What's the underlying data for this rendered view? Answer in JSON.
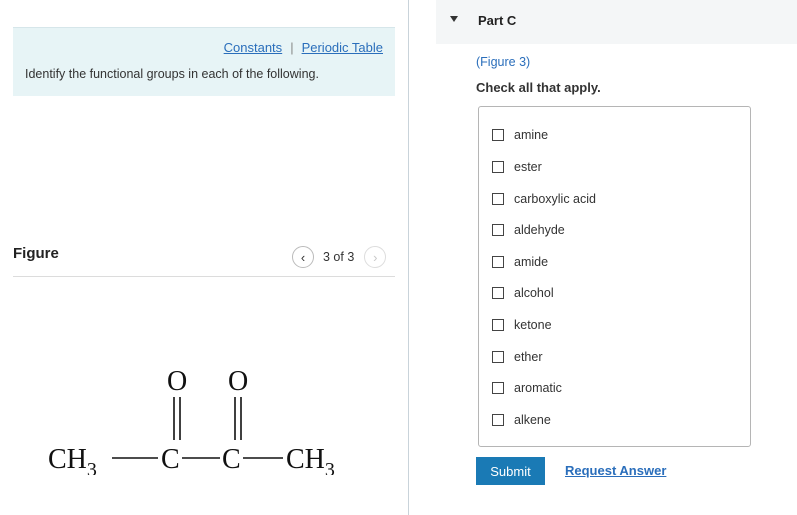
{
  "info": {
    "constants_link": "Constants",
    "separator": "|",
    "periodic_table_link": "Periodic Table",
    "instruction": "Identify the functional groups in each of the following."
  },
  "figure": {
    "label": "Figure",
    "page_indicator": "3 of 3",
    "molecule": {
      "ch3_left": "CH",
      "ch3_left_sub": "3",
      "ch3_right": "CH",
      "ch3_right_sub": "3",
      "carbon": "C",
      "oxygen": "O"
    }
  },
  "part": {
    "title": "Part C",
    "figure_link": "(Figure 3)",
    "prompt": "Check all that apply.",
    "options": [
      "amine",
      "ester",
      "carboxylic acid",
      "aldehyde",
      "amide",
      "alcohol",
      "ketone",
      "ether",
      "aromatic",
      "alkene"
    ],
    "submit_label": "Submit",
    "request_answer_label": "Request Answer"
  },
  "colors": {
    "accent": "#1a7ab5",
    "link": "#2a6ebb",
    "info_bg": "#e7f4f6"
  }
}
